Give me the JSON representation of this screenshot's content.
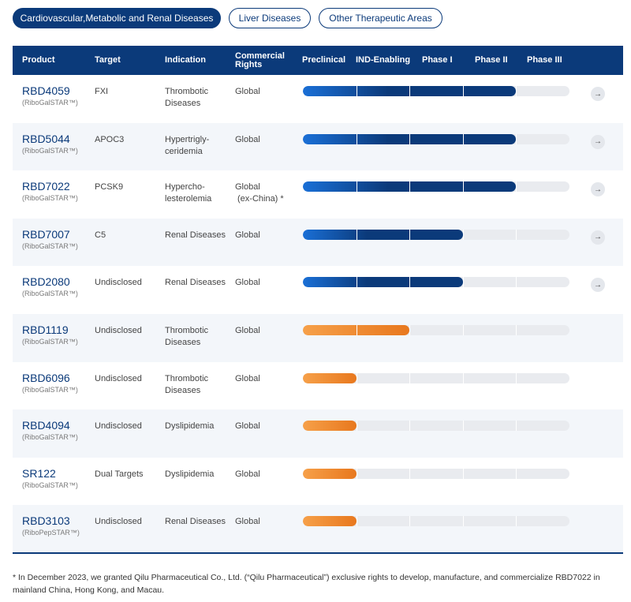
{
  "tabs": [
    {
      "label": "Cardiovascular,Metabolic and Renal Diseases",
      "active": true
    },
    {
      "label": "Liver Diseases",
      "active": false
    },
    {
      "label": "Other Therapeutic Areas",
      "active": false
    }
  ],
  "columns": {
    "product": "Product",
    "target": "Target",
    "indication": "Indication",
    "rights_line1": "Commercial",
    "rights_line2": "Rights",
    "phases": [
      "Preclinical",
      "IND-Enabling",
      "Phase I",
      "Phase II",
      "Phase III"
    ]
  },
  "rows": [
    {
      "product": "RBD4059",
      "platform": "(RiboGalSTAR™)",
      "target": "FXI",
      "indication_1": "Thrombotic",
      "indication_2": "Diseases",
      "rights_1": "Global",
      "rights_2": "",
      "progress_phases": 4,
      "color": "blue",
      "has_arrow": true
    },
    {
      "product": "RBD5044",
      "platform": "(RiboGalSTAR™)",
      "target": "APOC3",
      "indication_1": "Hypertrigly-",
      "indication_2": "ceridemia",
      "rights_1": "Global",
      "rights_2": "",
      "progress_phases": 4,
      "color": "blue",
      "has_arrow": true
    },
    {
      "product": "RBD7022",
      "platform": "(RiboGalSTAR™)",
      "target": "PCSK9",
      "indication_1": "Hypercho-",
      "indication_2": "lesterolemia",
      "rights_1": "Global",
      "rights_2": "(ex-China) *",
      "progress_phases": 4,
      "color": "blue",
      "has_arrow": true
    },
    {
      "product": "RBD7007",
      "platform": "(RiboGalSTAR™)",
      "target": "C5",
      "indication_1": "Renal Diseases",
      "indication_2": "",
      "rights_1": "Global",
      "rights_2": "",
      "progress_phases": 3,
      "color": "blue",
      "has_arrow": true
    },
    {
      "product": "RBD2080",
      "platform": "(RiboGalSTAR™)",
      "target": "Undisclosed",
      "indication_1": "Renal Diseases",
      "indication_2": "",
      "rights_1": "Global",
      "rights_2": "",
      "progress_phases": 3,
      "color": "blue",
      "has_arrow": true
    },
    {
      "product": "RBD1119",
      "platform": "(RiboGalSTAR™)",
      "target": "Undisclosed",
      "indication_1": "Thrombotic",
      "indication_2": "Diseases",
      "rights_1": "Global",
      "rights_2": "",
      "progress_phases": 2,
      "color": "orange",
      "has_arrow": false
    },
    {
      "product": "RBD6096",
      "platform": "(RiboGalSTAR™)",
      "target": "Undisclosed",
      "indication_1": "Thrombotic",
      "indication_2": "Diseases",
      "rights_1": "Global",
      "rights_2": "",
      "progress_phases": 1,
      "color": "orange",
      "has_arrow": false
    },
    {
      "product": "RBD4094",
      "platform": "(RiboGalSTAR™)",
      "target": "Undisclosed",
      "indication_1": "Dyslipidemia",
      "indication_2": "",
      "rights_1": "Global",
      "rights_2": "",
      "progress_phases": 1,
      "color": "orange",
      "has_arrow": false
    },
    {
      "product": "SR122",
      "platform": "(RiboGalSTAR™)",
      "target": "Dual Targets",
      "indication_1": "Dyslipidemia",
      "indication_2": "",
      "rights_1": "Global",
      "rights_2": "",
      "progress_phases": 1,
      "color": "orange",
      "has_arrow": false
    },
    {
      "product": "RBD3103",
      "platform": "(RiboPepSTAR™)",
      "target": "Undisclosed",
      "indication_1": "Renal Diseases",
      "indication_2": "",
      "rights_1": "Global",
      "rights_2": "",
      "progress_phases": 1,
      "color": "orange",
      "has_arrow": false
    }
  ],
  "arrow_glyph": "→",
  "footnote": "* In December 2023, we granted Qilu Pharmaceutical Co., Ltd. (“Qilu Pharmaceutical”) exclusive rights to develop, manufacture, and commercialize RBD7022 in mainland China, Hong Kong, and Macau.",
  "colors": {
    "brand": "#0b3a7a",
    "accent_orange": "#e8781e",
    "track": "#e9ebef"
  }
}
